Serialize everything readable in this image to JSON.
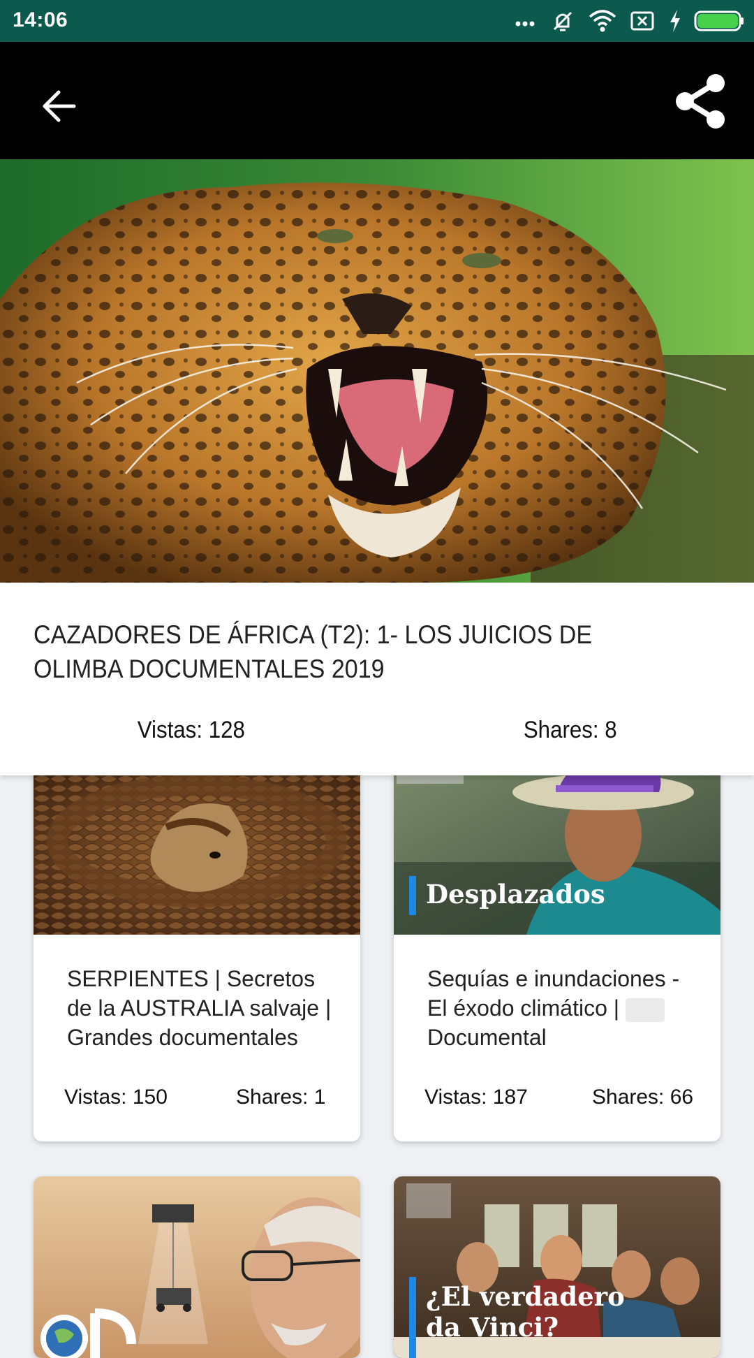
{
  "status_bar": {
    "time": "14:06",
    "icons": [
      "more-icon",
      "vibrate-off-icon",
      "wifi-icon",
      "sim-off-icon",
      "charging-icon",
      "battery-icon"
    ],
    "battery_color": "#47d14a"
  },
  "app_bar": {
    "back_icon": "arrow-back-icon",
    "share_icon": "share-icon"
  },
  "video": {
    "title": "CAZADORES DE ÁFRICA (T2): 1- LOS JUICIOS DE OLIMBA DOCUMENTALES 2019",
    "views": "Vistas: 128",
    "shares": "Shares: 8"
  },
  "related": [
    {
      "title": "SERPIENTES | Secretos de la AUSTRALIA salvaje  | Grandes documentales",
      "views": "Vistas: 150",
      "shares": "Shares: 1"
    },
    {
      "overlay": "Desplazados",
      "title": "Sequías e inundaciones - El éxodo climático | ",
      "title_end": "Documental",
      "views": "Vistas: 187",
      "shares": "Shares: 66"
    },
    {
      "title": ""
    },
    {
      "overlay_line1": "¿El verdadero",
      "overlay_line2": "da Vinci?"
    }
  ],
  "colors": {
    "status_bar": "#0b5a4d",
    "app_bar": "#000000",
    "background": "#eef1f4",
    "accent_blue": "#1e88e5"
  }
}
